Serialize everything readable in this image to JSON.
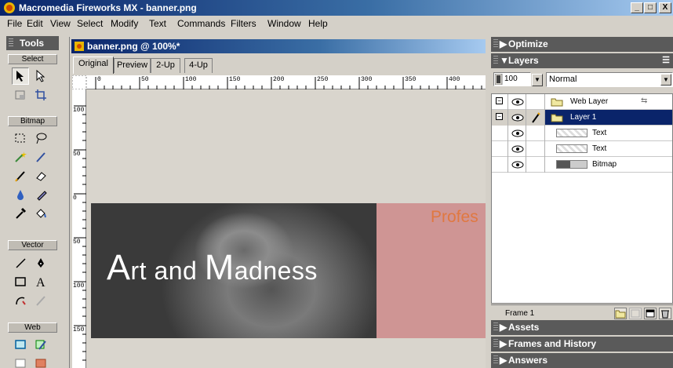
{
  "window": {
    "title": "Macromedia Fireworks MX - banner.png",
    "min": "_",
    "max": "□",
    "close": "X"
  },
  "menu": [
    "File",
    "Edit",
    "View",
    "Select",
    "Modify",
    "Text",
    "Commands",
    "Filters",
    "Window",
    "Help"
  ],
  "tools": {
    "header": "Tools",
    "sections": {
      "select": "Select",
      "bitmap": "Bitmap",
      "vector": "Vector",
      "web": "Web"
    }
  },
  "document": {
    "title": "banner.png @ 100%*",
    "tabs": [
      "Original",
      "Preview",
      "2-Up",
      "4-Up"
    ],
    "active_tab": "Original",
    "ruler_h": [
      "0",
      "50",
      "100",
      "150",
      "200",
      "250",
      "300",
      "350",
      "400"
    ],
    "ruler_v": [
      "100",
      "50",
      "0",
      "50",
      "100",
      "150"
    ]
  },
  "banner": {
    "headline_a": "A",
    "headline_b": "rt and ",
    "headline_c": "M",
    "headline_d": "adness",
    "side_text": "Profes",
    "colors": {
      "pink": "#cf9594",
      "orange": "#e07840"
    }
  },
  "panels": {
    "optimize": "Optimize",
    "layers": "Layers",
    "opacity": "100",
    "blend_mode": "Normal",
    "layer_rows": [
      {
        "name": "Web Layer",
        "type": "folder"
      },
      {
        "name": "Layer 1",
        "type": "folder",
        "selected": true
      },
      {
        "name": "Text",
        "type": "object"
      },
      {
        "name": "Text",
        "type": "object"
      },
      {
        "name": "Bitmap",
        "type": "bitmap"
      }
    ],
    "frame_label": "Frame 1",
    "assets": "Assets",
    "frames_history": "Frames and History",
    "answers": "Answers"
  }
}
